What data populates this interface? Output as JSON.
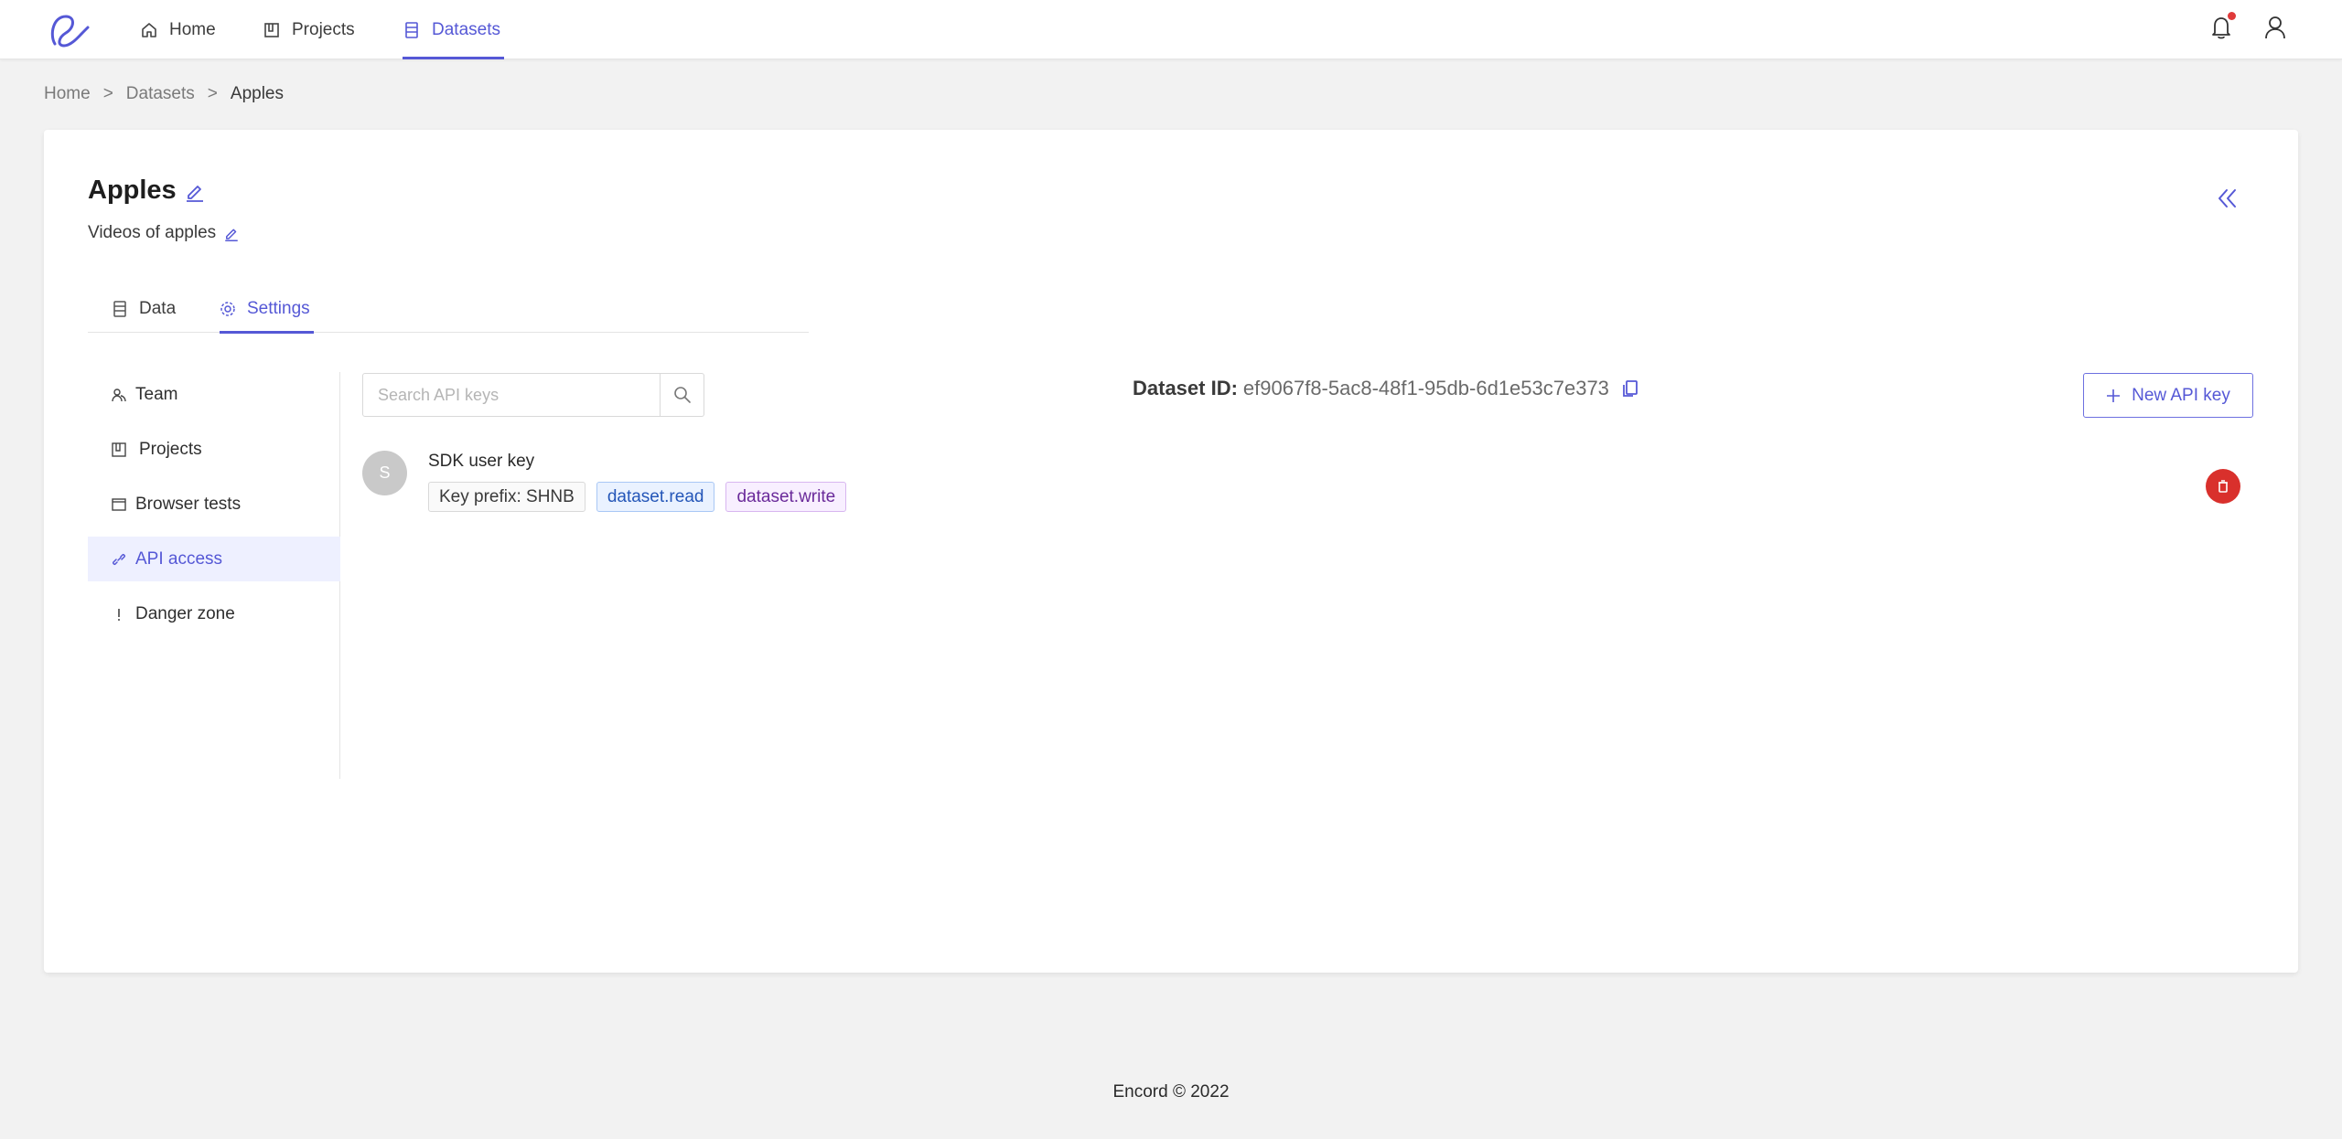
{
  "nav": {
    "items": [
      {
        "label": "Home",
        "icon": "home-icon"
      },
      {
        "label": "Projects",
        "icon": "projects-icon"
      },
      {
        "label": "Datasets",
        "icon": "datasets-icon",
        "active": true
      }
    ],
    "accent_color": "#5558d6"
  },
  "breadcrumb": {
    "items": [
      "Home",
      "Datasets",
      "Apples"
    ],
    "separator": ">"
  },
  "dataset": {
    "title": "Apples",
    "description": "Videos of apples",
    "id_label": "Dataset ID:",
    "id_value": "ef9067f8-5ac8-48f1-95db-6d1e53c7e373"
  },
  "tabs": [
    {
      "label": "Data",
      "icon": "data-icon"
    },
    {
      "label": "Settings",
      "icon": "gear-icon",
      "active": true
    }
  ],
  "side_menu": [
    {
      "label": "Team",
      "icon": "team-icon"
    },
    {
      "label": "Projects",
      "icon": "projects-icon"
    },
    {
      "label": "Browser tests",
      "icon": "browser-icon"
    },
    {
      "label": "API access",
      "icon": "link-icon",
      "active": true
    },
    {
      "label": "Danger zone",
      "icon": "exclamation-icon"
    }
  ],
  "search": {
    "placeholder": "Search API keys"
  },
  "actions": {
    "new_key_label": "New API key"
  },
  "api_keys": [
    {
      "avatar_letter": "S",
      "name": "SDK user key",
      "prefix_label": "Key prefix: SHNB",
      "scopes": [
        "dataset.read",
        "dataset.write"
      ]
    }
  ],
  "footer": {
    "text": "Encord © 2022"
  }
}
